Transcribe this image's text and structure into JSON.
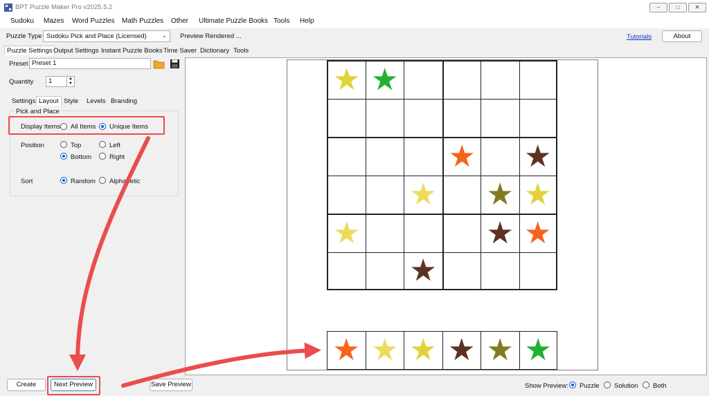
{
  "window": {
    "title": "BPT Puzzle Maker Pro v2025.5.2",
    "min": "–",
    "max": "□",
    "close": "✕"
  },
  "menu": [
    "Sudoku",
    "Mazes",
    "Word Puzzles",
    "Math Puzzles",
    "Other",
    "Ultimate Puzzle Books",
    "Tools",
    "Help"
  ],
  "toolbar": {
    "puzzle_type_label": "Puzzle Type",
    "puzzle_type_value": "Sudoku Pick and Place (Licensed)",
    "status": "Preview Rendered ...",
    "tutorials": "Tutorials",
    "about": "About"
  },
  "main_tabs": [
    "Puzzle Settings",
    "Output Settings",
    "Instant Puzzle Books",
    "Time Saver",
    "Dictionary",
    "Tools"
  ],
  "preset": {
    "label": "Preset",
    "value": "Preset 1"
  },
  "quantity": {
    "label": "Quantity",
    "value": "1"
  },
  "sub_tabs": [
    "Settings",
    "Layout",
    "Style",
    "Levels",
    "Branding"
  ],
  "group": {
    "title": "Pick and Place",
    "display_items_label": "Display Items",
    "display_all": "All Items",
    "display_unique": "Unique Items",
    "position_label": "Position",
    "pos_top": "Top",
    "pos_left": "Left",
    "pos_bottom": "Bottom",
    "pos_right": "Right",
    "sort_label": "Sort",
    "sort_random": "Random",
    "sort_alpha": "Alphabetic"
  },
  "grid": [
    [
      "yellow",
      "green",
      "",
      "",
      "",
      ""
    ],
    [
      "",
      "",
      "",
      "",
      "",
      ""
    ],
    [
      "",
      "",
      "",
      "orange",
      "",
      "brown"
    ],
    [
      "",
      "",
      "paleyellow",
      "",
      "olive",
      "yellow"
    ],
    [
      "paleyellow",
      "",
      "",
      "",
      "brown",
      "orange"
    ],
    [
      "",
      "",
      "brown",
      "",
      "",
      ""
    ]
  ],
  "pick_row": [
    "orange",
    "paleyellow",
    "yellow",
    "brown",
    "olive",
    "green"
  ],
  "star_colors": {
    "yellow": "#e2d23a",
    "paleyellow": "#eddc5c",
    "green": "#24b032",
    "orange": "#f5641d",
    "brown": "#5e3222",
    "olive": "#817a20"
  },
  "bottom": {
    "create": "Create",
    "next_preview": "Next Preview",
    "save_preview": "Save Preview",
    "show_preview_label": "Show Preview:",
    "opt_puzzle": "Puzzle",
    "opt_solution": "Solution",
    "opt_both": "Both"
  },
  "annotation_color": "#ea4d4d"
}
